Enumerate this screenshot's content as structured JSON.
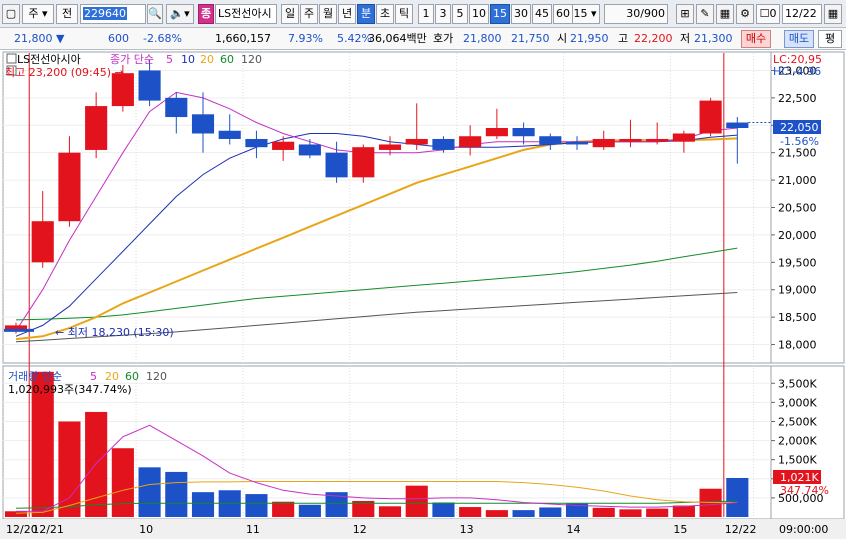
{
  "toolbar": {
    "market_select": "주",
    "type_select": "전",
    "code": "229640",
    "badge": "종",
    "name": "LS전선아시",
    "periods": [
      "일",
      "주",
      "월",
      "년",
      "분",
      "초",
      "틱"
    ],
    "active_period": "분",
    "intervals": [
      "1",
      "3",
      "5",
      "10",
      "15",
      "30",
      "45",
      "60"
    ],
    "active_interval": "15",
    "interval_input": "15",
    "count": "30/900",
    "checkbox_value": "0",
    "date": "12/22"
  },
  "quote": {
    "price": "21,800",
    "change": "600",
    "change_pct": "-2.68%",
    "volume": "1,660,157",
    "rate1": "7.93%",
    "rate2": "5.42%",
    "amount": "36,064백만",
    "bid_label": "호가",
    "bid1": "21,800",
    "bid2": "21,750",
    "open_label": "시",
    "open": "21,950",
    "high_label": "고",
    "high": "22,200",
    "low_label": "저",
    "low": "21,300",
    "buy_button": "매수",
    "sell_button": "매도",
    "eval_button": "평"
  },
  "colors": {
    "up": "#e3131d",
    "down": "#1c51c8",
    "ma5": "#c62fc6",
    "ma10": "#1d2fb5",
    "ma20": "#e8a616",
    "ma60": "#128c2a",
    "ma120": "#555555",
    "current_price_bg": "#1c51c8",
    "volume_badge_bg": "#e3131d"
  },
  "chart_data": {
    "type": "candlestick",
    "price_panel": {
      "legend_name": "LS전선아시아",
      "ma_label": "종가 단순",
      "ma_periods": [
        "5",
        "10",
        "20",
        "60",
        "120"
      ],
      "lc_label": "LC:20,95",
      "hc_label": "HC:-4.96",
      "high_annotation": "최고 23,200 (09:45) →",
      "low_annotation": "← 최저 18,230 (15:30)",
      "ylim": [
        17700,
        23300
      ],
      "yticks": [
        18000,
        18500,
        19000,
        19500,
        20000,
        20500,
        21000,
        21500,
        22000,
        22500,
        23000
      ],
      "ytick_labels": [
        "18,000",
        "18,500",
        "19,000",
        "19,500",
        "20,000",
        "20,500",
        "21,000",
        "21,500",
        "22,000",
        "22,500",
        "23,000"
      ],
      "current_price_label": "22,050",
      "current_change_label": "-1.56%",
      "current_price": 22050,
      "candles": [
        {
          "o": 18250,
          "h": 18400,
          "l": 18200,
          "c": 18350
        },
        {
          "o": 19500,
          "h": 20800,
          "l": 19400,
          "c": 20250
        },
        {
          "o": 20250,
          "h": 21800,
          "l": 20150,
          "c": 21500
        },
        {
          "o": 21550,
          "h": 22600,
          "l": 21400,
          "c": 22350
        },
        {
          "o": 22350,
          "h": 23100,
          "l": 22250,
          "c": 22950
        },
        {
          "o": 23000,
          "h": 23200,
          "l": 22350,
          "c": 22450
        },
        {
          "o": 22500,
          "h": 22600,
          "l": 21850,
          "c": 22150
        },
        {
          "o": 22200,
          "h": 22600,
          "l": 21500,
          "c": 21850
        },
        {
          "o": 21900,
          "h": 22200,
          "l": 21650,
          "c": 21750
        },
        {
          "o": 21750,
          "h": 21900,
          "l": 21400,
          "c": 21600
        },
        {
          "o": 21550,
          "h": 21800,
          "l": 21350,
          "c": 21700
        },
        {
          "o": 21650,
          "h": 21750,
          "l": 21400,
          "c": 21450
        },
        {
          "o": 21500,
          "h": 21700,
          "l": 20950,
          "c": 21050
        },
        {
          "o": 21050,
          "h": 21650,
          "l": 20950,
          "c": 21600
        },
        {
          "o": 21550,
          "h": 21800,
          "l": 21450,
          "c": 21650
        },
        {
          "o": 21650,
          "h": 22400,
          "l": 21550,
          "c": 21750
        },
        {
          "o": 21750,
          "h": 21800,
          "l": 21500,
          "c": 21550
        },
        {
          "o": 21600,
          "h": 22000,
          "l": 21450,
          "c": 21800
        },
        {
          "o": 21800,
          "h": 22300,
          "l": 21750,
          "c": 21950
        },
        {
          "o": 21950,
          "h": 22050,
          "l": 21650,
          "c": 21800
        },
        {
          "o": 21800,
          "h": 21850,
          "l": 21550,
          "c": 21650
        },
        {
          "o": 21700,
          "h": 21800,
          "l": 21550,
          "c": 21650
        },
        {
          "o": 21600,
          "h": 21900,
          "l": 21550,
          "c": 21750
        },
        {
          "o": 21700,
          "h": 22100,
          "l": 21600,
          "c": 21750
        },
        {
          "o": 21700,
          "h": 22050,
          "l": 21650,
          "c": 21750
        },
        {
          "o": 21700,
          "h": 21900,
          "l": 21500,
          "c": 21850
        },
        {
          "o": 21850,
          "h": 22500,
          "l": 21800,
          "c": 22450
        },
        {
          "o": 22050,
          "h": 22150,
          "l": 21300,
          "c": 21950
        }
      ],
      "ma": {
        "ma5": [
          18250,
          19000,
          19900,
          20700,
          21500,
          22250,
          22600,
          22500,
          22300,
          22050,
          21850,
          21700,
          21550,
          21500,
          21500,
          21500,
          21550,
          21650,
          21700,
          21700,
          21700,
          21700,
          21700,
          21700,
          21700,
          21750,
          21900,
          21950
        ],
        "ma10": [
          18150,
          18350,
          18700,
          19200,
          19700,
          20200,
          20700,
          21100,
          21400,
          21600,
          21750,
          21850,
          21850,
          21800,
          21700,
          21650,
          21600,
          21600,
          21600,
          21620,
          21650,
          21680,
          21700,
          21700,
          21700,
          21720,
          21780,
          21820
        ],
        "ma20": [
          18100,
          18150,
          18300,
          18500,
          18750,
          18950,
          19150,
          19350,
          19550,
          19750,
          19950,
          20150,
          20350,
          20550,
          20750,
          20950,
          21100,
          21250,
          21400,
          21550,
          21650,
          21700,
          21720,
          21730,
          21730,
          21730,
          21740,
          21760
        ],
        "ma60": [
          18450,
          18460,
          18480,
          18500,
          18540,
          18600,
          18660,
          18720,
          18780,
          18840,
          18880,
          18920,
          18960,
          19000,
          19040,
          19080,
          19120,
          19160,
          19200,
          19240,
          19280,
          19330,
          19390,
          19450,
          19520,
          19600,
          19680,
          19760
        ],
        "ma120": [
          18050,
          18080,
          18110,
          18140,
          18170,
          18200,
          18230,
          18270,
          18310,
          18350,
          18390,
          18430,
          18470,
          18510,
          18550,
          18590,
          18620,
          18650,
          18680,
          18710,
          18740,
          18770,
          18800,
          18830,
          18860,
          18890,
          18920,
          18950
        ]
      }
    },
    "volume_panel": {
      "legend": "거래량 단순",
      "ma_periods": [
        "5",
        "20",
        "60",
        "120"
      ],
      "value_label": "1,020,993주(347.74%)",
      "ylim": [
        0,
        3900
      ],
      "yticks": [
        500,
        1000,
        1500,
        2000,
        2500,
        3000,
        3500
      ],
      "ytick_labels": [
        "500,000",
        "1,000K",
        "1,500K",
        "2,000K",
        "2,500K",
        "3,000K",
        "3,500K"
      ],
      "current_label": "1,021K",
      "current_pct_label": "347.74%",
      "current_value": 1021,
      "values_k": [
        150,
        3800,
        2500,
        2750,
        1800,
        1300,
        1180,
        650,
        700,
        600,
        400,
        320,
        650,
        420,
        280,
        820,
        380,
        260,
        180,
        180,
        250,
        350,
        240,
        200,
        220,
        300,
        740,
        1021
      ],
      "ma5": [
        150,
        150,
        500,
        1400,
        2100,
        2400,
        2000,
        1600,
        1150,
        900,
        700,
        600,
        550,
        500,
        480,
        480,
        500,
        500,
        450,
        380,
        340,
        300,
        280,
        260,
        260,
        280,
        320,
        380
      ],
      "ma20": [
        100,
        120,
        300,
        500,
        700,
        850,
        900,
        920,
        920,
        930,
        930,
        930,
        930,
        930,
        930,
        930,
        930,
        930,
        930,
        900,
        850,
        780,
        680,
        550,
        450,
        400,
        380,
        380
      ],
      "ma60": [
        230,
        240,
        270,
        320,
        350,
        360,
        360,
        360,
        360,
        360,
        360,
        360,
        360,
        360,
        360,
        360,
        360,
        360,
        360,
        360,
        360,
        360,
        360,
        360,
        360,
        380,
        400,
        420
      ]
    },
    "x_labels": [
      "12/20",
      "12/21",
      "10",
      "11",
      "12",
      "13",
      "14",
      "15",
      "12/22"
    ],
    "x_label_index": [
      0,
      1,
      5,
      9,
      13,
      17,
      21,
      25,
      28
    ],
    "time_label": "09:00:00"
  }
}
